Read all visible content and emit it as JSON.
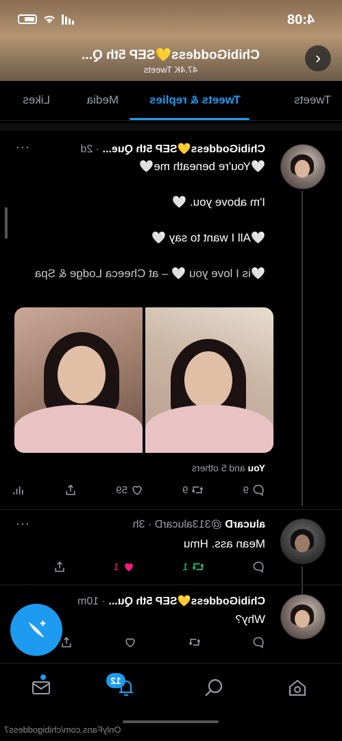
{
  "status": {
    "time": "4:08"
  },
  "header": {
    "name": "ChibiGoddess💛SEP 5th Q...",
    "subtitle": "47.4K Tweets"
  },
  "tabs": [
    "Tweets",
    "Tweets & replies",
    "Media",
    "Likes"
  ],
  "active_tab": "Tweets & replies",
  "tweets": [
    {
      "author": "ChibiGoddess💛SEP 5th Que...",
      "time": "· 2d",
      "lines": [
        "🤍You're beneath me🤍",
        "I'm above you. 🤍",
        "🤍All I want to say 🤍",
        "🤍is I love you 🤍 – at Cheeca Lodge & Spa"
      ],
      "likers_you": "You",
      "likers_rest": " and 5 others",
      "replies": "9",
      "retweets": "9",
      "likes": "59"
    },
    {
      "author": "alucarD",
      "handle": "@313alucarD · 3h",
      "text": "Mean ass. Hmu",
      "retweets": "1",
      "likes": "1"
    },
    {
      "author": "ChibiGoddess💛SEP 5th Qu...",
      "time": "· 10m",
      "text": "Why?"
    }
  ],
  "nav": {
    "notifications_badge": "12"
  },
  "watermark": "OnlyFans.com/chibigoddess7",
  "colors": {
    "accent": "#1d9bf0",
    "retweet": "#19cf86",
    "like": "#f91880",
    "bg": "#000000"
  },
  "icons": [
    "back-arrow-icon",
    "reply-icon",
    "retweet-icon",
    "heart-icon",
    "share-icon",
    "analytics-icon",
    "home-icon",
    "search-icon",
    "bell-icon",
    "mail-icon",
    "compose-icon",
    "more-icon"
  ]
}
